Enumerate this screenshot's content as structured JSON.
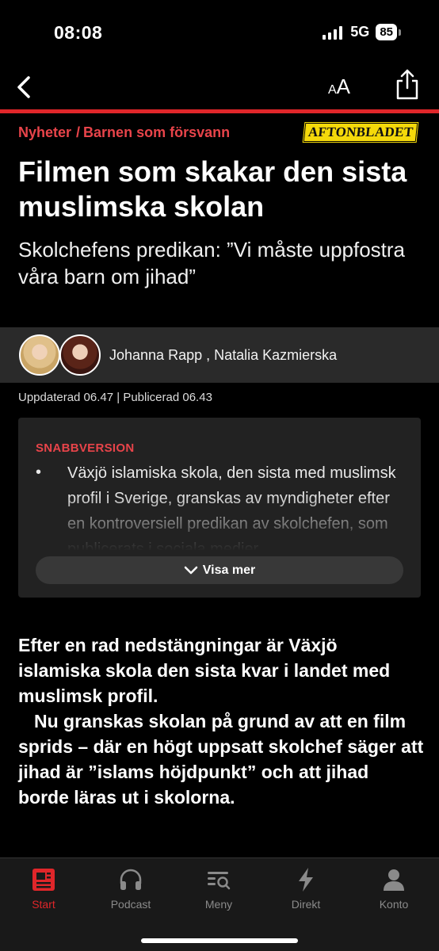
{
  "status_bar": {
    "time": "08:08",
    "network": "5G",
    "battery": "85"
  },
  "nav": {
    "text_size_small": "A",
    "text_size_large": "A"
  },
  "article": {
    "breadcrumb": {
      "section": "Nyheter",
      "separator": "/",
      "topic": "Barnen som försvann"
    },
    "brand": "AFTONBLADET",
    "headline": "Filmen som skakar den sista muslimska skolan",
    "subheadline": "Skolchefens predikan: ”Vi måste uppfostra våra barn om jihad”",
    "authors": "Johanna Rapp , Natalia Kazmierska",
    "meta": "Uppdaterad 06.47 | Publicerad 06.43",
    "summary": {
      "label": "SNABBVERSION",
      "bullet": "•",
      "text": "Växjö islamiska skola, den sista med muslimsk profil i Sverige, granskas av myndigheter efter en kontroversiell predikan av skolchefen, som publicerats i sociala medier.",
      "show_more": "Visa mer"
    },
    "body": [
      "Efter en rad nedstängningar är Växjö islamiska skola den sista kvar i landet med muslimsk profil.",
      "Nu granskas skolan på grund av att en film sprids – där en högt uppsatt skolchef säger att jihad är ”islams höjdpunkt” och att jihad borde läras ut i skolorna."
    ]
  },
  "tabs": [
    {
      "label": "Start",
      "icon": "newspaper-icon",
      "active": true
    },
    {
      "label": "Podcast",
      "icon": "headphones-icon",
      "active": false
    },
    {
      "label": "Meny",
      "icon": "menu-search-icon",
      "active": false
    },
    {
      "label": "Direkt",
      "icon": "lightning-icon",
      "active": false
    },
    {
      "label": "Konto",
      "icon": "person-icon",
      "active": false
    }
  ],
  "colors": {
    "accent": "#e0262a",
    "brand_yellow": "#f5d90a",
    "background": "#000000"
  }
}
